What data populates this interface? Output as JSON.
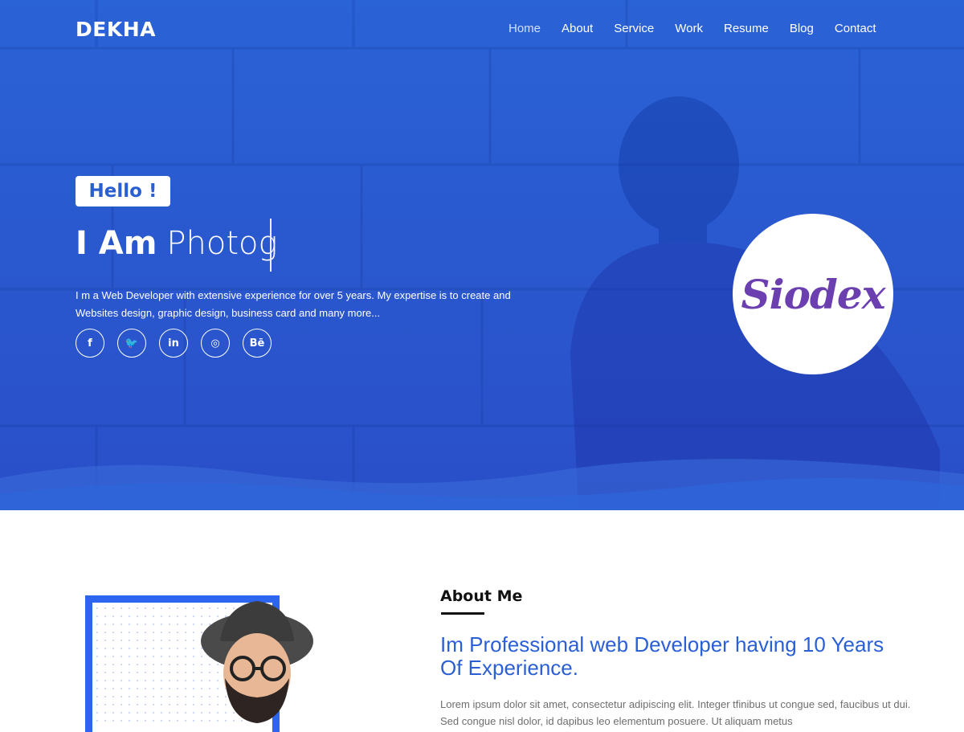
{
  "header": {
    "logo": "DEKHA",
    "nav": [
      "Home",
      "About",
      "Service",
      "Work",
      "Resume",
      "Blog",
      "Contact"
    ],
    "active_nav": "Home"
  },
  "hero": {
    "greeting": "Hello !",
    "headline_bold": "I Am",
    "headline_typed": "Photog",
    "intro": "I m a Web Developer with extensive experience for over 5 years. My expertise is to create and Websites design, graphic design, business card and many more...",
    "social": [
      {
        "icon": "facebook-icon",
        "glyph": "f"
      },
      {
        "icon": "twitter-icon",
        "glyph": "🐦"
      },
      {
        "icon": "linkedin-icon",
        "glyph": "in"
      },
      {
        "icon": "instagram-icon",
        "glyph": "◎"
      },
      {
        "icon": "behance-icon",
        "glyph": "Bē"
      }
    ],
    "brand_badge": "Siodex"
  },
  "about": {
    "title": "About Me",
    "headline": "Im Professional web Developer having 10 Years Of Experience.",
    "text": "Lorem ipsum dolor sit amet, consectetur adipiscing elit. Integer tfinibus ut congue sed, faucibus ut dui. Sed congue nisl dolor, id dapibus leo elementum posuere. Ut aliquam metus"
  },
  "colors": {
    "hero_blue": "#2a5cd2",
    "accent_blue": "#2c66f0",
    "brand_purple": "#6b3fb0"
  }
}
